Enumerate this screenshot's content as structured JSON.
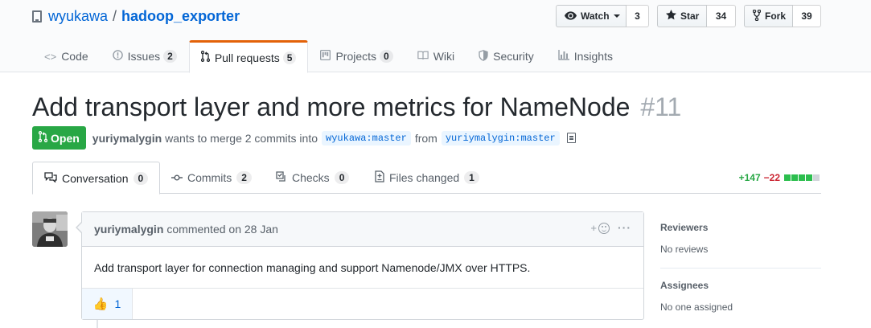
{
  "repo": {
    "owner": "wyukawa",
    "separator": "/",
    "name": "hadoop_exporter"
  },
  "actions": {
    "watch": {
      "label": "Watch",
      "count": "3",
      "icon": "eye-icon"
    },
    "star": {
      "label": "Star",
      "count": "34",
      "icon": "star-icon"
    },
    "fork": {
      "label": "Fork",
      "count": "39",
      "icon": "fork-icon"
    }
  },
  "reponav": [
    {
      "label": "Code",
      "icon": "code-icon",
      "count": ""
    },
    {
      "label": "Issues",
      "icon": "issue-icon",
      "count": "2"
    },
    {
      "label": "Pull requests",
      "icon": "pull-request-icon",
      "count": "5",
      "selected": true
    },
    {
      "label": "Projects",
      "icon": "project-icon",
      "count": "0"
    },
    {
      "label": "Wiki",
      "icon": "book-icon",
      "count": ""
    },
    {
      "label": "Security",
      "icon": "shield-icon",
      "count": ""
    },
    {
      "label": "Insights",
      "icon": "graph-icon",
      "count": ""
    }
  ],
  "pr": {
    "title": "Add transport layer and more metrics for NameNode",
    "number": "#11",
    "state": "Open",
    "author": "yuriymalygin",
    "merge_text": "wants to merge 2 commits into",
    "base_branch": "wyukawa:master",
    "from_text": "from",
    "head_branch": "yuriymalygin:master"
  },
  "prtabs": [
    {
      "label": "Conversation",
      "count": "0",
      "icon": "comment-discussion-icon",
      "selected": true
    },
    {
      "label": "Commits",
      "count": "2",
      "icon": "commit-icon"
    },
    {
      "label": "Checks",
      "count": "0",
      "icon": "checklist-icon"
    },
    {
      "label": "Files changed",
      "count": "1",
      "icon": "file-diff-icon"
    }
  ],
  "diffstat": {
    "additions": "+147",
    "deletions": "−22",
    "green_blocks": 4,
    "total_blocks": 5
  },
  "comment": {
    "author": "yuriymalygin",
    "meta": "commented on 28 Jan",
    "body": "Add transport layer for connection managing and support Namenode/JMX over HTTPS.",
    "reaction_emoji": "👍",
    "reaction_count": "1"
  },
  "sidebar": {
    "reviewers_label": "Reviewers",
    "reviewers_value": "No reviews",
    "assignees_label": "Assignees",
    "assignees_value": "No one assigned"
  },
  "colors": {
    "link": "#0366d6",
    "open_state": "#28a745",
    "additions": "#28a745",
    "deletions": "#cb2431",
    "selected_tab_accent": "#e36209"
  }
}
